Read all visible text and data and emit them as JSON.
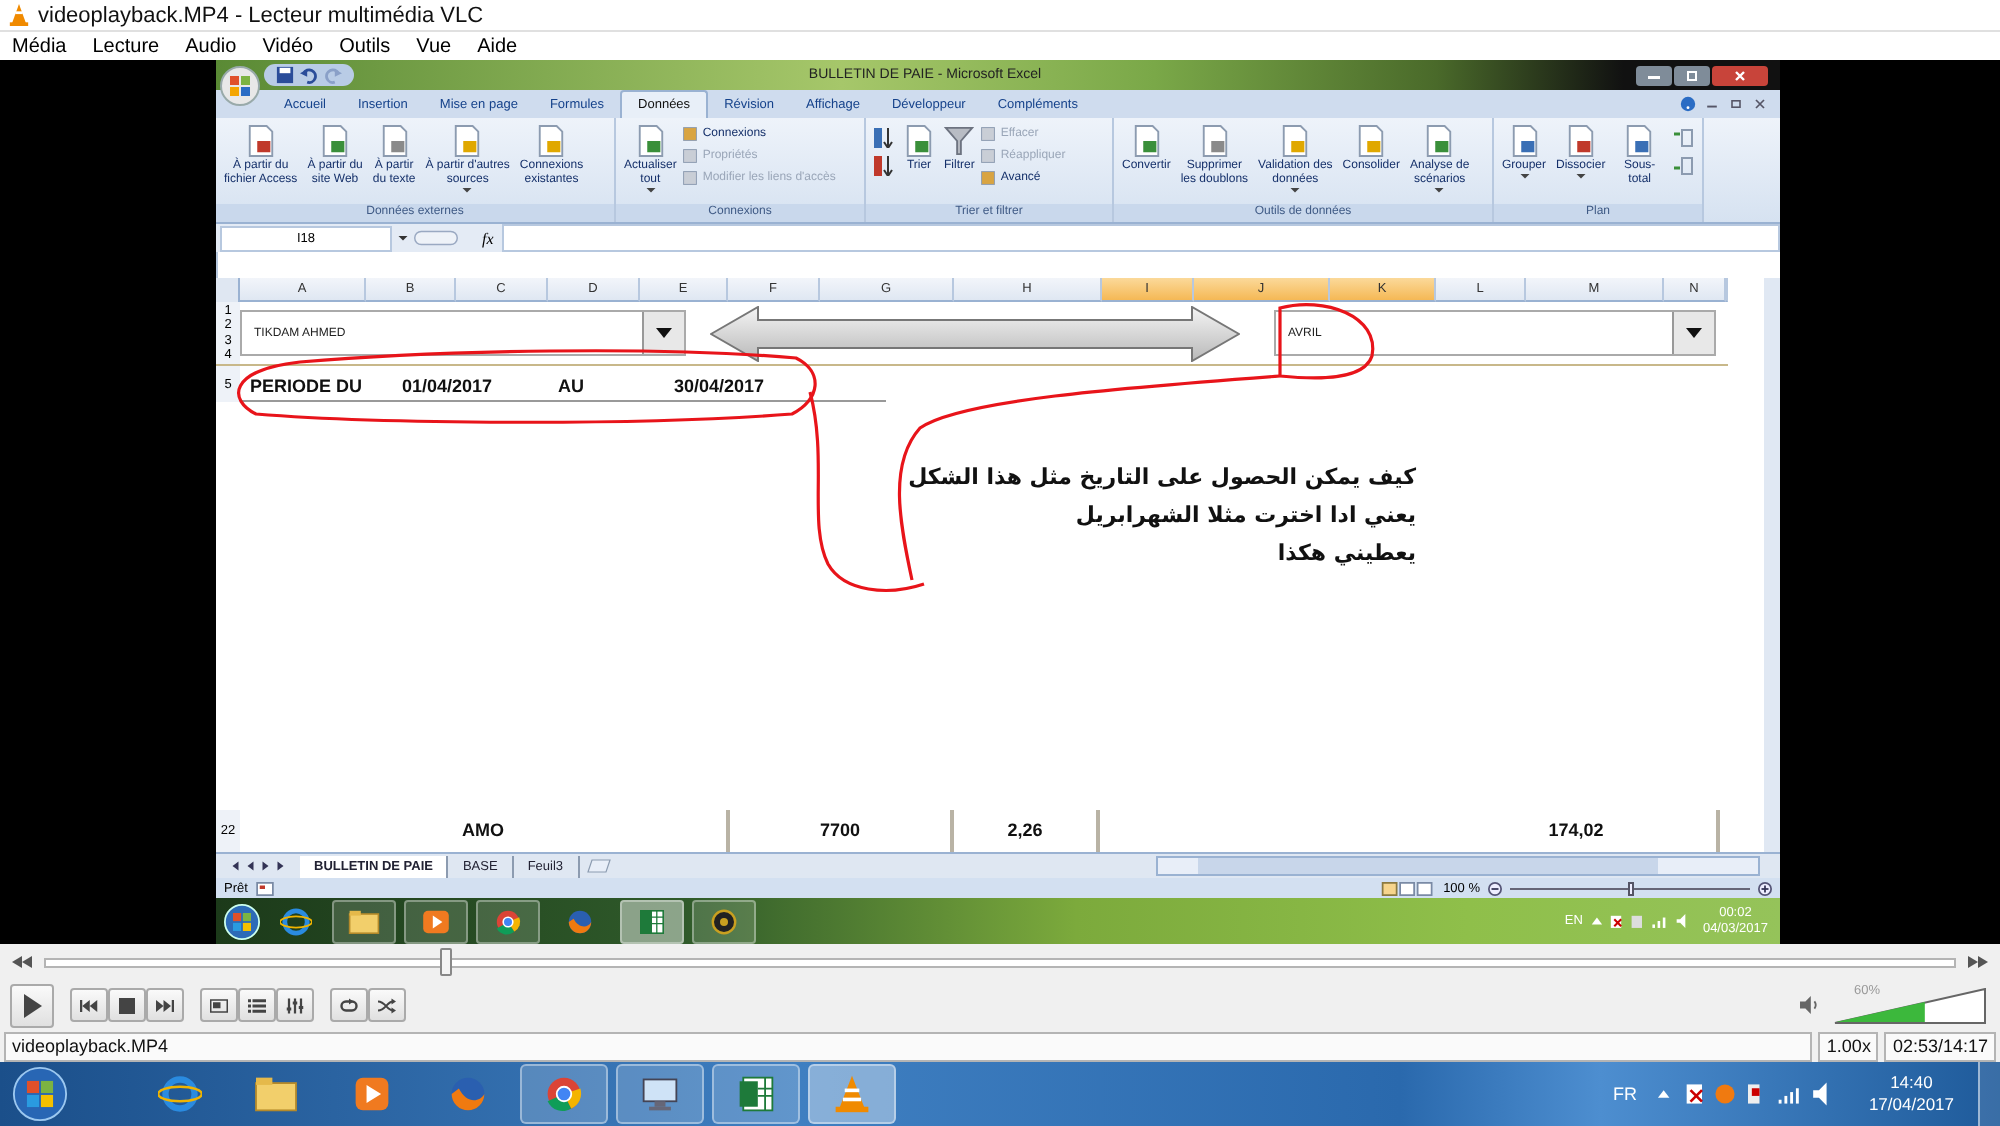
{
  "window": {
    "title": "videoplayback.MP4 - Lecteur multimédia VLC"
  },
  "menu": [
    {
      "label": "Média"
    },
    {
      "label": "Lecture"
    },
    {
      "label": "Audio"
    },
    {
      "label": "Vidéo"
    },
    {
      "label": "Outils"
    },
    {
      "label": "Vue"
    },
    {
      "label": "Aide"
    }
  ],
  "excel": {
    "title": "BULLETIN DE PAIE - Microsoft Excel",
    "tabs": [
      {
        "label": "Accueil",
        "selected": false
      },
      {
        "label": "Insertion",
        "selected": false
      },
      {
        "label": "Mise en page",
        "selected": false
      },
      {
        "label": "Formules",
        "selected": false
      },
      {
        "label": "Données",
        "selected": true
      },
      {
        "label": "Révision",
        "selected": false
      },
      {
        "label": "Affichage",
        "selected": false
      },
      {
        "label": "Développeur",
        "selected": false
      },
      {
        "label": "Compléments",
        "selected": false
      }
    ],
    "groups": [
      {
        "label": "Données externes",
        "items": [
          {
            "kind": "large",
            "label": "À partir du\nfichier Access"
          },
          {
            "kind": "large",
            "label": "À partir du\nsite Web"
          },
          {
            "kind": "large",
            "label": "À partir\ndu texte"
          },
          {
            "kind": "large",
            "label": "À partir d'autres\nsources",
            "dropdown": true
          },
          {
            "kind": "large",
            "label": "Connexions\nexistantes"
          }
        ]
      },
      {
        "label": "Connexions",
        "items": [
          {
            "kind": "large",
            "label": "Actualiser\ntout",
            "dropdown": true
          },
          {
            "kind": "stack",
            "items": [
              {
                "label": "Connexions",
                "disabled": false
              },
              {
                "label": "Propriétés",
                "disabled": true
              },
              {
                "label": "Modifier les liens d'accès",
                "disabled": true
              }
            ]
          }
        ]
      },
      {
        "label": "Trier et filtrer",
        "items": [
          {
            "kind": "sortpair"
          },
          {
            "kind": "large",
            "label": "Trier"
          },
          {
            "kind": "filter",
            "label": "Filtrer"
          },
          {
            "kind": "stack",
            "items": [
              {
                "label": "Effacer",
                "disabled": true
              },
              {
                "label": "Réappliquer",
                "disabled": true
              },
              {
                "label": "Avancé",
                "disabled": false
              }
            ]
          }
        ]
      },
      {
        "label": "Outils de données",
        "items": [
          {
            "kind": "large",
            "label": "Convertir"
          },
          {
            "kind": "large",
            "label": "Supprimer\nles doublons"
          },
          {
            "kind": "large",
            "label": "Validation des\ndonnées",
            "dropdown": true
          },
          {
            "kind": "large",
            "label": "Consolider"
          },
          {
            "kind": "large",
            "label": "Analyse de\nscénarios",
            "dropdown": true
          }
        ]
      },
      {
        "label": "Plan",
        "items": [
          {
            "kind": "large",
            "label": "Grouper",
            "dropdown": true
          },
          {
            "kind": "large",
            "label": "Dissocier",
            "dropdown": true
          },
          {
            "kind": "large",
            "label": "Sous-total"
          },
          {
            "kind": "iconpair"
          }
        ]
      }
    ],
    "name_box": "I18",
    "fx": "fx",
    "columns": [
      {
        "label": "A",
        "selected": false
      },
      {
        "label": "B",
        "selected": false
      },
      {
        "label": "C",
        "selected": false
      },
      {
        "label": "D",
        "selected": false
      },
      {
        "label": "E",
        "selected": false
      },
      {
        "label": "F",
        "selected": false
      },
      {
        "label": "G",
        "selected": false
      },
      {
        "label": "H",
        "selected": false
      },
      {
        "label": "I",
        "selected": true
      },
      {
        "label": "J",
        "selected": true
      },
      {
        "label": "K",
        "selected": true
      },
      {
        "label": "L",
        "selected": false
      },
      {
        "label": "M",
        "selected": false
      },
      {
        "label": "N",
        "selected": false
      }
    ],
    "row_numbers": [
      "1",
      "2",
      "3",
      "4"
    ],
    "employee": "TIKDAM AHMED",
    "month": "AVRIL",
    "period": {
      "row": "5",
      "label": "PERIODE DU",
      "from": "01/04/2017",
      "to_label": "AU",
      "to": "30/04/2017"
    },
    "note_lines": [
      "كيف يمكن الحصول على التاريخ مثل هذا الشكل",
      "يعني ادا اخترت مثلا الشهرابريل",
      "يعطيني هكذا"
    ],
    "total_row": {
      "row": "22",
      "cells": [
        "AMO",
        "7700",
        "2,26",
        "174,02"
      ]
    },
    "sheets": [
      {
        "label": "BULLETIN DE PAIE",
        "selected": true
      },
      {
        "label": "BASE",
        "selected": false
      },
      {
        "label": "Feuil3",
        "selected": false
      }
    ],
    "status": "Prêt",
    "zoom": {
      "reading": "100 %",
      "level": 0.5
    },
    "taskbar": {
      "lang": "EN",
      "time": "00:02",
      "date": "04/03/2017"
    }
  },
  "player": {
    "seek": {
      "level": 0.21
    },
    "volume": {
      "level": 0.6,
      "reading": "60%"
    },
    "file": "videoplayback.MP4",
    "speed": "1.00x",
    "time": "02:53/14:17"
  },
  "taskbar": {
    "lang": "FR",
    "time": "14:40",
    "date": "17/04/2017"
  }
}
